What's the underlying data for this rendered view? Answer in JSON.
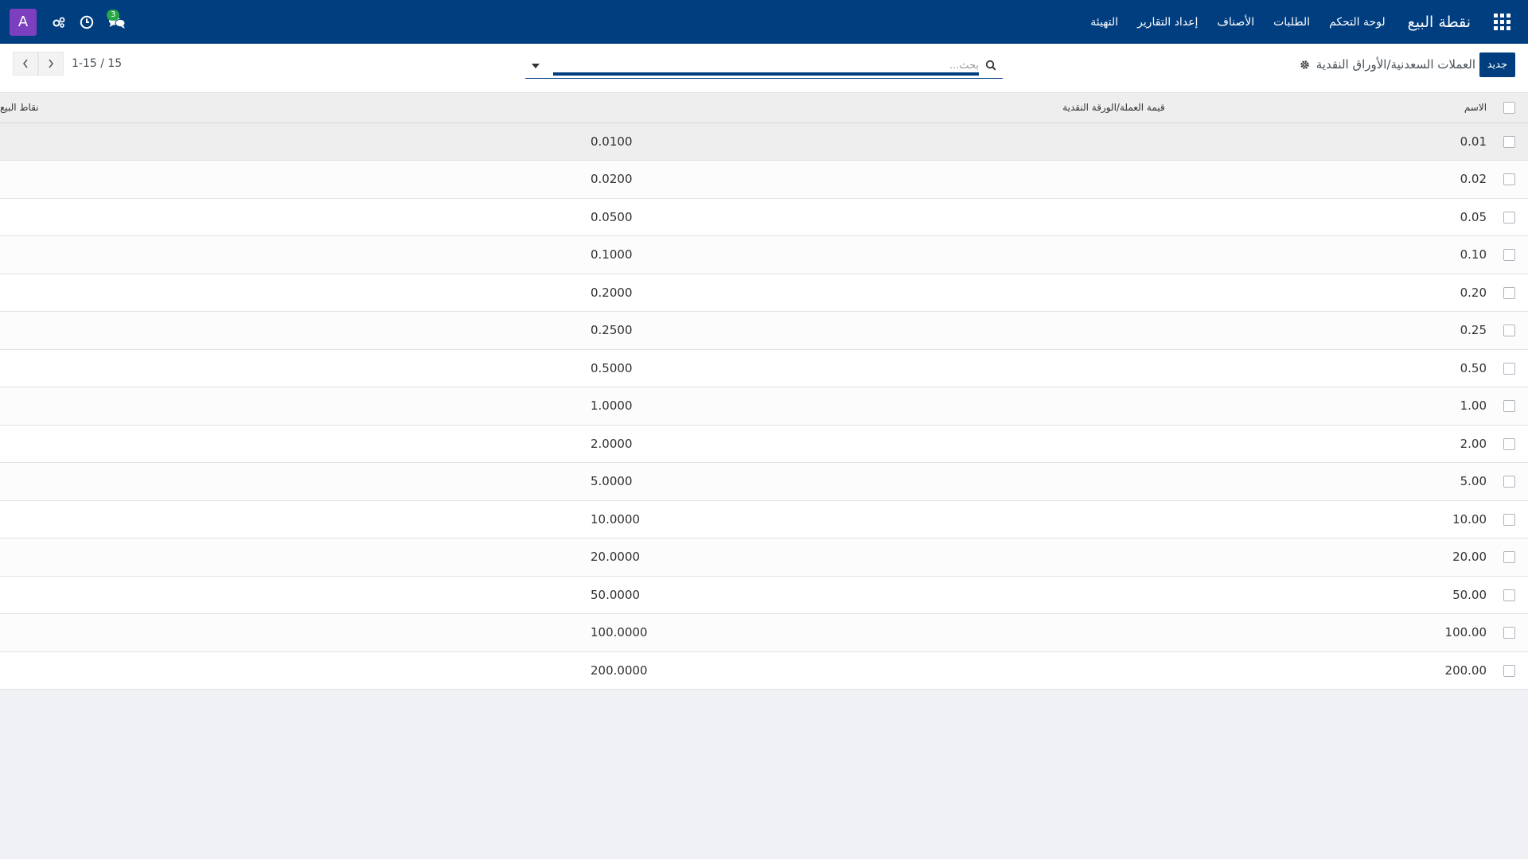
{
  "navbar": {
    "brand": "نقطة البيع",
    "menu": [
      "لوحة التحكم",
      "الطلبات",
      "الأصناف",
      "إعداد التقارير",
      "التهيئة"
    ],
    "messages_count": "3",
    "avatar_letter": "A"
  },
  "control_panel": {
    "new_button": "جديد",
    "breadcrumb": "العملات السعدنية/الأوراق النقدية",
    "search_placeholder": "بحث...",
    "pager_value": "1-15 / 15"
  },
  "table": {
    "columns": {
      "name": "الاسم",
      "value": "قيمة العملة/الورقة النقدية",
      "pos": "نقاط البيع"
    },
    "rows": [
      {
        "name": "0.01",
        "value": "0.0100"
      },
      {
        "name": "0.02",
        "value": "0.0200"
      },
      {
        "name": "0.05",
        "value": "0.0500"
      },
      {
        "name": "0.10",
        "value": "0.1000"
      },
      {
        "name": "0.20",
        "value": "0.2000"
      },
      {
        "name": "0.25",
        "value": "0.2500"
      },
      {
        "name": "0.50",
        "value": "0.5000"
      },
      {
        "name": "1.00",
        "value": "1.0000"
      },
      {
        "name": "2.00",
        "value": "2.0000"
      },
      {
        "name": "5.00",
        "value": "5.0000"
      },
      {
        "name": "10.00",
        "value": "10.0000"
      },
      {
        "name": "20.00",
        "value": "20.0000"
      },
      {
        "name": "50.00",
        "value": "50.0000"
      },
      {
        "name": "100.00",
        "value": "100.0000"
      },
      {
        "name": "200.00",
        "value": "200.0000"
      }
    ]
  },
  "colors": {
    "primary": "#013e80",
    "avatar": "#7b3fbf",
    "badge": "#28a745"
  }
}
